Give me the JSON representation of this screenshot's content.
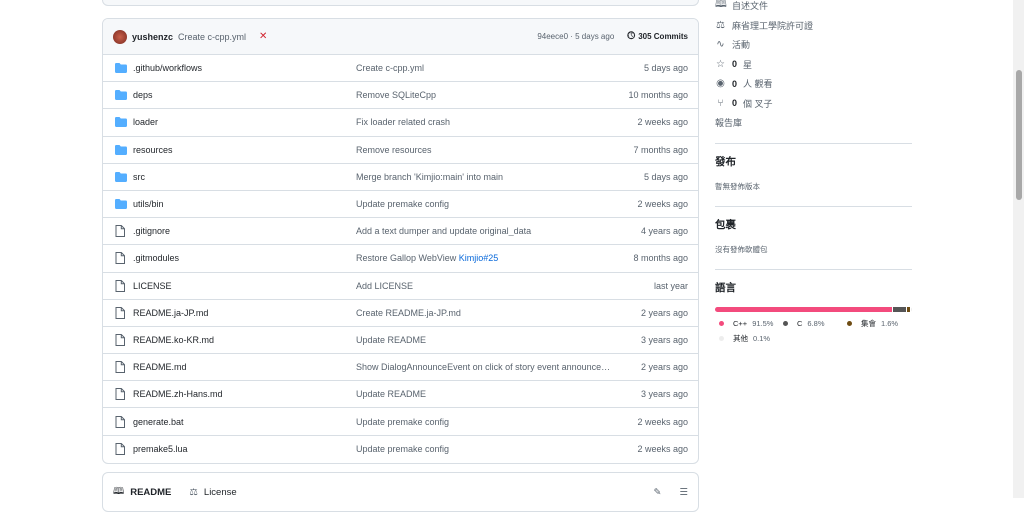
{
  "latest_commit": {
    "user": "yushenzc",
    "message": "Create c-cpp.yml",
    "status": "failed",
    "sha_time": "94eece0 · 5 days ago",
    "commits": "305 Commits"
  },
  "files": [
    {
      "type": "dir",
      "name": ".github/workflows",
      "message": "Create c-cpp.yml",
      "age": "5 days ago"
    },
    {
      "type": "dir",
      "name": "deps",
      "message": "Remove SQLiteCpp",
      "age": "10 months ago"
    },
    {
      "type": "dir",
      "name": "loader",
      "message": "Fix loader related crash",
      "age": "2 weeks ago"
    },
    {
      "type": "dir",
      "name": "resources",
      "message": "Remove resources",
      "age": "7 months ago"
    },
    {
      "type": "dir",
      "name": "src",
      "message": "Merge branch 'Kimjio:main' into main",
      "age": "5 days ago"
    },
    {
      "type": "dir",
      "name": "utils/bin",
      "message": "Update premake config",
      "age": "2 weeks ago"
    },
    {
      "type": "file",
      "name": ".gitignore",
      "message": "Add a text dumper and update original_data",
      "age": "4 years ago"
    },
    {
      "type": "file",
      "name": ".gitmodules",
      "message": "Restore Gallop WebView ",
      "link": "Kimjio#25",
      "age": "8 months ago"
    },
    {
      "type": "file",
      "name": "LICENSE",
      "message": "Add LICENSE",
      "age": "last year"
    },
    {
      "type": "file",
      "name": "README.ja-JP.md",
      "message": "Create README.ja-JP.md",
      "age": "2 years ago"
    },
    {
      "type": "file",
      "name": "README.ko-KR.md",
      "message": "Update README",
      "age": "3 years ago"
    },
    {
      "type": "file",
      "name": "README.md",
      "message": "Show DialogAnnounceEvent on click of story event announcement",
      "age": "2 years ago"
    },
    {
      "type": "file",
      "name": "README.zh-Hans.md",
      "message": "Update README",
      "age": "3 years ago"
    },
    {
      "type": "file",
      "name": "generate.bat",
      "message": "Update premake config",
      "age": "2 weeks ago"
    },
    {
      "type": "file",
      "name": "premake5.lua",
      "message": "Update premake config",
      "age": "2 weeks ago"
    }
  ],
  "readme_tabs": {
    "readme": "README",
    "license": "License"
  },
  "sidebar": {
    "about": [
      {
        "icon": "book-icon",
        "label": "自述文件"
      },
      {
        "icon": "scale-icon",
        "label": "麻省理工學院許可證"
      },
      {
        "icon": "pulse-icon",
        "label": "活動"
      }
    ],
    "stats": [
      {
        "icon": "star-icon",
        "count": "0",
        "label": "星"
      },
      {
        "icon": "eye-icon",
        "count": "0",
        "label": "人 觀看"
      },
      {
        "icon": "fork-icon",
        "count": "0",
        "label": "個 叉子"
      }
    ],
    "report": "報告庫",
    "releases": {
      "title": "發布",
      "empty": "暫無發佈版本"
    },
    "packages": {
      "title": "包裹",
      "empty": "沒有發佈軟體包"
    },
    "languages": {
      "title": "語言",
      "items": [
        {
          "name": "C++",
          "percent": "91.5%",
          "value": 91.5,
          "color": "#f34b7d"
        },
        {
          "name": "C",
          "percent": "6.8%",
          "value": 6.8,
          "color": "#555555"
        },
        {
          "name": "集會",
          "percent": "1.6%",
          "value": 1.6,
          "color": "#6e4c13"
        },
        {
          "name": "其他",
          "percent": "0.1%",
          "value": 0.1,
          "color": "#ededed"
        }
      ]
    }
  }
}
